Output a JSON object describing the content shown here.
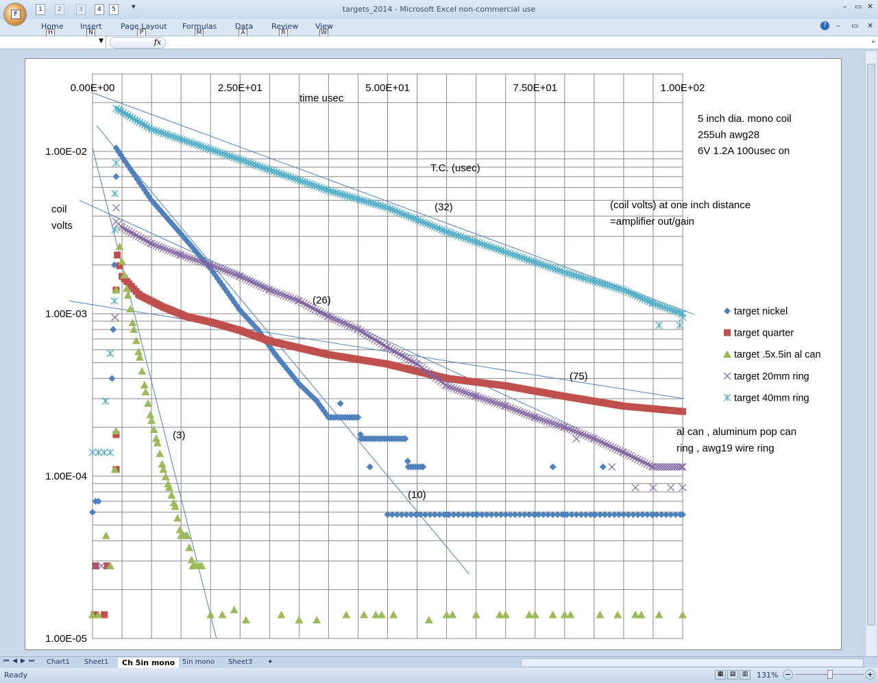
{
  "window": {
    "title": "targets_2014 - Microsoft Excel non-commercial use",
    "office_key": "F",
    "qat_keys": [
      "1",
      "2",
      "3",
      "4",
      "5"
    ]
  },
  "ribbon": {
    "tabs": [
      {
        "label": "Home",
        "key": "H"
      },
      {
        "label": "Insert",
        "key": "N"
      },
      {
        "label": "Page Layout",
        "key": "P"
      },
      {
        "label": "Formulas",
        "key": "M"
      },
      {
        "label": "Data",
        "key": "A"
      },
      {
        "label": "Review",
        "key": "R"
      },
      {
        "label": "View",
        "key": "W"
      }
    ]
  },
  "formula_bar": {
    "fx": "fx",
    "name_box": "",
    "formula": ""
  },
  "sheet_tabs": [
    "Chart1",
    "Sheet1",
    "Ch 5in mono",
    "5in mono",
    "Sheet3"
  ],
  "active_sheet": "Ch 5in mono",
  "status": {
    "ready": "Ready",
    "zoom": "131%"
  },
  "chart_data": {
    "type": "scatter",
    "title": "",
    "xlabel": "time usec",
    "ylabel": "coil volts",
    "xlim": [
      0,
      100
    ],
    "ylim": [
      1e-05,
      0.03
    ],
    "yscale": "log",
    "x_ticks": [
      "0.00E+00",
      "2.50E+01",
      "5.00E+01",
      "7.50E+01",
      "1.00E+02"
    ],
    "x_tick_values": [
      0,
      25,
      50,
      75,
      100
    ],
    "y_ticks": [
      "1.00E-02",
      "1.00E-03",
      "1.00E-04",
      "1.00E-05"
    ],
    "y_tick_values": [
      0.01,
      0.001,
      0.0001,
      1e-05
    ],
    "grid": true,
    "legend_placement": "right",
    "annotations": {
      "coil": [
        "5 inch dia. mono coil",
        "255uh  awg28",
        "6V   1.2A    100usec on"
      ],
      "tc": "T.C. (usec)",
      "coil_volts_note": [
        "(coil volts) at one inch distance",
        "=amplifier out/gain"
      ],
      "targets_note": [
        "al can ,  aluminum  pop can",
        "ring ,    awg19 wire ring"
      ],
      "tc_labels": [
        "(32)",
        "(26)",
        "(75)",
        "(3)",
        "(10)"
      ]
    },
    "series": [
      {
        "name": "target nickel",
        "color": "#4F81BD",
        "marker": "diamond",
        "curve": [
          [
            4,
            0.0105
          ],
          [
            10,
            0.005
          ],
          [
            15,
            0.0031
          ],
          [
            20,
            0.0019
          ],
          [
            25,
            0.00105
          ],
          [
            28,
            0.0008
          ],
          [
            31,
            0.00056
          ],
          [
            35,
            0.00037
          ],
          [
            38,
            0.00029
          ],
          [
            40,
            0.00023
          ],
          [
            45,
            0.00023
          ],
          [
            45.5,
            0.00017
          ],
          [
            53,
            0.00017
          ],
          [
            53.5,
            0.000114
          ],
          [
            56,
            0.000114
          ]
        ],
        "extra": [
          [
            0,
            6e-05
          ],
          [
            0.5,
            7e-05
          ],
          [
            1,
            7e-05
          ],
          [
            3.3,
            0.0004
          ],
          [
            3.5,
            0.0008
          ],
          [
            3.7,
            0.002
          ],
          [
            4,
            0.007
          ],
          [
            42,
            0.00028
          ],
          [
            47,
            0.000114
          ],
          [
            50,
            5.8e-05
          ],
          [
            55,
            5.8e-05
          ],
          [
            60,
            5.8e-05
          ],
          [
            65,
            5.8e-05
          ],
          [
            70,
            5.8e-05
          ],
          [
            75,
            5.8e-05
          ],
          [
            78,
            0.000114
          ],
          [
            80,
            5.8e-05
          ],
          [
            85,
            5.8e-05
          ],
          [
            86.5,
            0.000114
          ],
          [
            90,
            5.8e-05
          ],
          [
            95,
            5.8e-05
          ],
          [
            100,
            5.8e-05
          ]
        ],
        "flat": [
          [
            50,
            100,
            5.8e-05
          ]
        ]
      },
      {
        "name": "target quarter",
        "color": "#C0504D",
        "marker": "square",
        "curve": [
          [
            4.2,
            0.0023
          ],
          [
            5,
            0.0017
          ],
          [
            8,
            0.0013
          ],
          [
            12,
            0.0011
          ],
          [
            16,
            0.00096
          ],
          [
            20,
            0.00089
          ],
          [
            25,
            0.00079
          ],
          [
            30,
            0.00068
          ],
          [
            40,
            0.00056
          ],
          [
            50,
            0.00049
          ],
          [
            60,
            0.0004
          ],
          [
            70,
            0.00036
          ],
          [
            80,
            0.00031
          ],
          [
            90,
            0.00027
          ],
          [
            100,
            0.00025
          ]
        ],
        "extra": [
          [
            0.5,
            2.8e-05
          ],
          [
            2.5,
            2.8e-05
          ],
          [
            0.3,
            1.4e-05
          ],
          [
            2,
            1.4e-05
          ],
          [
            4,
            0.00011
          ],
          [
            4,
            0.00018
          ],
          [
            4,
            0.0014
          ]
        ],
        "flat": []
      },
      {
        "name": "target .5x.5in al can",
        "color": "#9BBB59",
        "marker": "triangle",
        "curve": [
          [
            4.6,
            0.0026
          ],
          [
            5,
            0.0021
          ],
          [
            6,
            0.0013
          ],
          [
            7,
            0.0008
          ],
          [
            8,
            0.00054
          ],
          [
            9,
            0.00033
          ],
          [
            10,
            0.00022
          ],
          [
            11,
            0.00016
          ],
          [
            12,
            0.00011
          ],
          [
            13,
            8.5e-05
          ],
          [
            14,
            6.5e-05
          ],
          [
            15,
            4.3e-05
          ],
          [
            16,
            4.3e-05
          ],
          [
            17,
            2.8e-05
          ],
          [
            18.5,
            2.8e-05
          ]
        ],
        "extra": [
          [
            0,
            1.4e-05
          ],
          [
            1,
            1.4e-05
          ],
          [
            2.3,
            4.3e-05
          ],
          [
            3,
            2.8e-05
          ],
          [
            3.8,
            0.00011
          ],
          [
            4,
            0.00019
          ],
          [
            4,
            0.0014
          ],
          [
            20,
            1.4e-05
          ],
          [
            22,
            1.4e-05
          ],
          [
            24,
            1.5e-05
          ],
          [
            26,
            1.3e-05
          ],
          [
            32,
            1.4e-05
          ],
          [
            35,
            1.3e-05
          ],
          [
            38,
            1.3e-05
          ],
          [
            43,
            1.4e-05
          ],
          [
            46,
            1.4e-05
          ],
          [
            48,
            1.4e-05
          ],
          [
            49,
            1.4e-05
          ],
          [
            51,
            1.4e-05
          ],
          [
            57,
            1.3e-05
          ],
          [
            60,
            1.4e-05
          ],
          [
            61,
            1.4e-05
          ],
          [
            65,
            1.4e-05
          ],
          [
            69,
            1.4e-05
          ],
          [
            70,
            1.4e-05
          ],
          [
            74,
            1.4e-05
          ],
          [
            75,
            1.4e-05
          ],
          [
            78,
            1.4e-05
          ],
          [
            80,
            1.4e-05
          ],
          [
            81,
            1.4e-05
          ],
          [
            86,
            1.4e-05
          ],
          [
            89,
            1.4e-05
          ],
          [
            92,
            1.4e-05
          ],
          [
            93,
            1.4e-05
          ],
          [
            96,
            1.4e-05
          ],
          [
            100,
            1.4e-05
          ]
        ],
        "flat": []
      },
      {
        "name": "target 20mm ring",
        "color": "#8064A2",
        "marker": "x",
        "curve": [
          [
            4,
            0.0037
          ],
          [
            5,
            0.0034
          ],
          [
            10,
            0.0027
          ],
          [
            15,
            0.0023
          ],
          [
            20,
            0.002
          ],
          [
            25,
            0.0017
          ],
          [
            30,
            0.0014
          ],
          [
            35,
            0.0012
          ],
          [
            40,
            0.00096
          ],
          [
            45,
            0.0008
          ],
          [
            50,
            0.00062
          ],
          [
            55,
            0.00049
          ],
          [
            60,
            0.00036
          ],
          [
            65,
            0.00031
          ],
          [
            70,
            0.00027
          ],
          [
            75,
            0.00023
          ],
          [
            80,
            0.0002
          ],
          [
            85,
            0.00017
          ],
          [
            90,
            0.00014
          ],
          [
            95,
            0.000114
          ],
          [
            100,
            0.000114
          ]
        ],
        "extra": [
          [
            0.5,
            2.8e-05
          ],
          [
            1.5,
            2.8e-05
          ],
          [
            3.8,
            0.00095
          ],
          [
            4,
            0.0045
          ],
          [
            92,
            8.5e-05
          ],
          [
            95,
            8.5e-05
          ],
          [
            98,
            8.5e-05
          ],
          [
            100,
            8.5e-05
          ],
          [
            88,
            0.000114
          ],
          [
            82,
            0.00017
          ]
        ],
        "flat": []
      },
      {
        "name": "target 40mm ring",
        "color": "#4BACC6",
        "marker": "star",
        "curve": [
          [
            4,
            0.0184
          ],
          [
            10,
            0.0137
          ],
          [
            20,
            0.0103
          ],
          [
            30,
            0.0077
          ],
          [
            40,
            0.00575
          ],
          [
            50,
            0.0045
          ],
          [
            60,
            0.0032
          ],
          [
            70,
            0.0024
          ],
          [
            80,
            0.0018
          ],
          [
            90,
            0.0014
          ],
          [
            95,
            0.00116
          ],
          [
            100,
            0.001
          ]
        ],
        "extra": [
          [
            0,
            0.00014
          ],
          [
            1,
            0.00014
          ],
          [
            2,
            0.00014
          ],
          [
            3,
            0.00014
          ],
          [
            2.2,
            0.00029
          ],
          [
            3,
            0.00057
          ],
          [
            3.7,
            0.0012
          ],
          [
            3.8,
            0.0033
          ],
          [
            3.8,
            0.0055
          ],
          [
            4,
            0.0085
          ],
          [
            96,
            0.00085
          ],
          [
            99.5,
            0.00085
          ],
          [
            100,
            0.00095
          ]
        ],
        "flat": []
      }
    ],
    "trendlines": [
      {
        "series": "target nickel",
        "tc": "(10)",
        "from": [
          0.7,
          0.0144
        ],
        "to": [
          63.8,
          2.5e-05
        ]
      },
      {
        "series": "target .5x.5in al can",
        "tc": "(3)",
        "from": [
          0,
          0.0105
        ],
        "to": [
          21,
          1e-05
        ]
      },
      {
        "series": "target 20mm ring",
        "tc": "(26)",
        "from": [
          -2.2,
          0.005
        ],
        "to": [
          82.6,
          0.000194
        ]
      },
      {
        "series": "target quarter",
        "tc": "(75)",
        "from": [
          -4,
          0.0012
        ],
        "to": [
          100.2,
          0.0003
        ]
      },
      {
        "series": "target 40mm ring",
        "tc": "(32)",
        "from": [
          0,
          0.023
        ],
        "to": [
          102,
          0.00099
        ]
      }
    ]
  }
}
